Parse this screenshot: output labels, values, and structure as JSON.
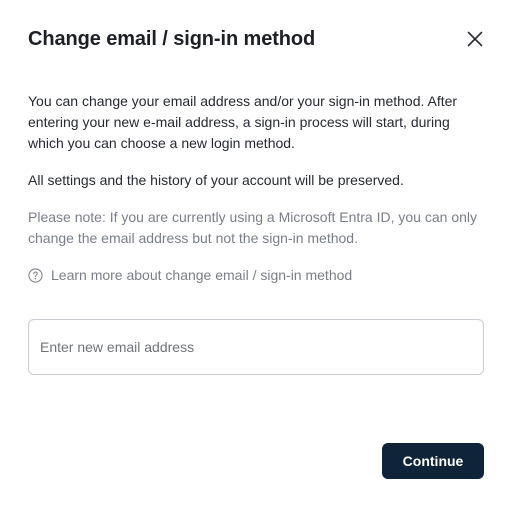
{
  "dialog": {
    "title": "Change email / sign-in method",
    "close_icon": "close-icon",
    "paragraphs": {
      "intro": "You can change your email address and/or your sign-in method. After entering your new e-mail address, a sign-in process will start, during which you can choose a new login method.",
      "preserved": "All settings and the history of your account will be preserved.",
      "note": "Please note: If you are currently using a Microsoft Entra ID, you can only change the email address but not the sign-in method."
    },
    "learn_more": {
      "icon": "help-circle-icon",
      "label": "Learn more about change email / sign-in method"
    },
    "email_input": {
      "value": "",
      "placeholder": "Enter new email address"
    },
    "continue_label": "Continue"
  },
  "colors": {
    "primary_button": "#0f2438",
    "muted_text": "#7a7f87",
    "input_border": "#c9ccd1"
  }
}
